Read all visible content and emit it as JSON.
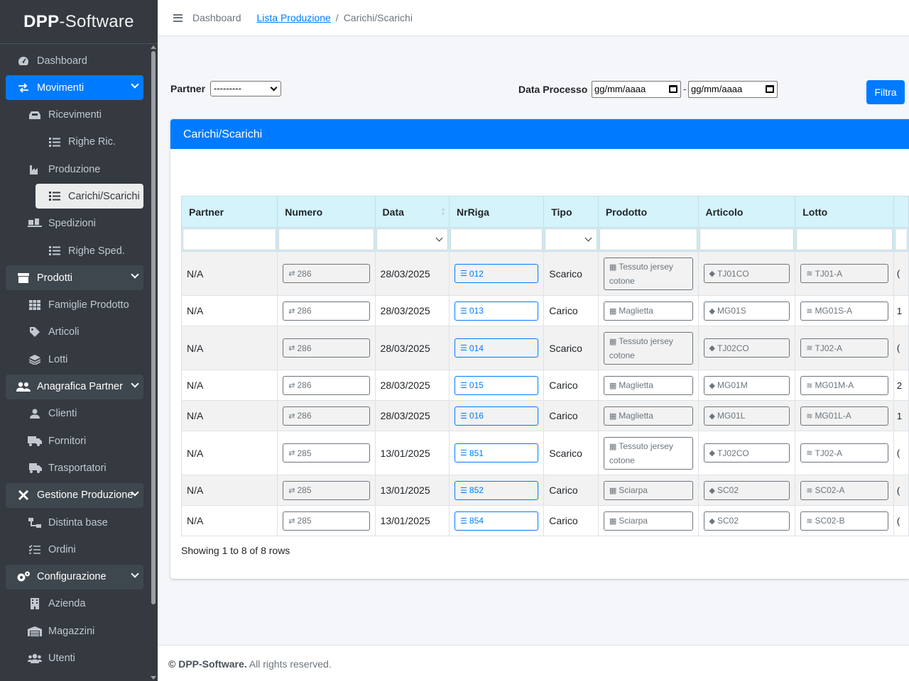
{
  "brand": {
    "bold": "DPP",
    "rest": "-Software"
  },
  "sidebar": {
    "items": [
      {
        "label": "Dashboard",
        "icon": "dashboard-icon"
      },
      {
        "label": "Movimenti",
        "icon": "exchange-icon"
      },
      {
        "label": "Ricevimenti",
        "icon": "inbox-icon"
      },
      {
        "label": "Righe Ric.",
        "icon": "list-icon"
      },
      {
        "label": "Produzione",
        "icon": "industry-icon"
      },
      {
        "label": "Carichi/Scarichi",
        "icon": "list-icon"
      },
      {
        "label": "Spedizioni",
        "icon": "shipping-icon"
      },
      {
        "label": "Righe Sped.",
        "icon": "list-icon"
      },
      {
        "label": "Prodotti",
        "icon": "box-icon"
      },
      {
        "label": "Famiglie Prodotto",
        "icon": "grid-icon"
      },
      {
        "label": "Articoli",
        "icon": "tag-icon"
      },
      {
        "label": "Lotti",
        "icon": "layers-icon"
      },
      {
        "label": "Anagrafica Partner",
        "icon": "users-icon"
      },
      {
        "label": "Clienti",
        "icon": "user-icon"
      },
      {
        "label": "Fornitori",
        "icon": "truck-icon"
      },
      {
        "label": "Trasportatori",
        "icon": "truck-moving-icon"
      },
      {
        "label": "Gestione Produzione",
        "icon": "tools-icon"
      },
      {
        "label": "Distinta base",
        "icon": "sitemap-icon"
      },
      {
        "label": "Ordini",
        "icon": "tasks-icon"
      },
      {
        "label": "Configurazione",
        "icon": "cogs-icon"
      },
      {
        "label": "Azienda",
        "icon": "building-icon"
      },
      {
        "label": "Magazzini",
        "icon": "warehouse-icon"
      },
      {
        "label": "Utenti",
        "icon": "users-cog-icon"
      }
    ]
  },
  "breadcrumb": {
    "home": "Dashboard",
    "link": "Lista Produzione",
    "sep": "/",
    "current": "Carichi/Scarichi"
  },
  "filters": {
    "partner_label": "Partner",
    "partner_value": "---------",
    "date_label": "Data Processo",
    "date_from": "gg/mm/aaaa",
    "date_sep": "-",
    "date_to": "gg/mm/aaaa",
    "button": "Filtra"
  },
  "card": {
    "title": "Carichi/Scarichi"
  },
  "table": {
    "columns": [
      "Partner",
      "Numero",
      "Data",
      "NrRiga",
      "Tipo",
      "Prodotto",
      "Articolo",
      "Lotto"
    ],
    "rows": [
      {
        "partner": "N/A",
        "numero": "286",
        "data": "28/03/2025",
        "nrriga": "012",
        "tipo": "Scarico",
        "prodotto": "Tessuto jersey cotone",
        "articolo": "TJ01CO",
        "lotto": "TJ01-A",
        "edge": "("
      },
      {
        "partner": "N/A",
        "numero": "286",
        "data": "28/03/2025",
        "nrriga": "013",
        "tipo": "Carico",
        "prodotto": "Maglietta",
        "articolo": "MG01S",
        "lotto": "MG01S-A",
        "edge": "1"
      },
      {
        "partner": "N/A",
        "numero": "286",
        "data": "28/03/2025",
        "nrriga": "014",
        "tipo": "Scarico",
        "prodotto": "Tessuto jersey cotone",
        "articolo": "TJ02CO",
        "lotto": "TJ02-A",
        "edge": "("
      },
      {
        "partner": "N/A",
        "numero": "286",
        "data": "28/03/2025",
        "nrriga": "015",
        "tipo": "Carico",
        "prodotto": "Maglietta",
        "articolo": "MG01M",
        "lotto": "MG01M-A",
        "edge": "2"
      },
      {
        "partner": "N/A",
        "numero": "286",
        "data": "28/03/2025",
        "nrriga": "016",
        "tipo": "Carico",
        "prodotto": "Maglietta",
        "articolo": "MG01L",
        "lotto": "MG01L-A",
        "edge": "1"
      },
      {
        "partner": "N/A",
        "numero": "285",
        "data": "13/01/2025",
        "nrriga": "851",
        "tipo": "Scarico",
        "prodotto": "Tessuto jersey cotone",
        "articolo": "TJ02CO",
        "lotto": "TJ02-A",
        "edge": "("
      },
      {
        "partner": "N/A",
        "numero": "285",
        "data": "13/01/2025",
        "nrriga": "852",
        "tipo": "Carico",
        "prodotto": "Sciarpa",
        "articolo": "SC02",
        "lotto": "SC02-A",
        "edge": "("
      },
      {
        "partner": "N/A",
        "numero": "285",
        "data": "13/01/2025",
        "nrriga": "854",
        "tipo": "Carico",
        "prodotto": "Sciarpa",
        "articolo": "SC02",
        "lotto": "SC02-B",
        "edge": "("
      }
    ],
    "showing": "Showing 1 to 8 of 8 rows"
  },
  "footer": {
    "brand": "© DPP-Software.",
    "text": " All rights reserved."
  },
  "colors": {
    "primary": "#007bff",
    "sidebar": "#343a40",
    "header_bg": "#d4f3fb"
  }
}
